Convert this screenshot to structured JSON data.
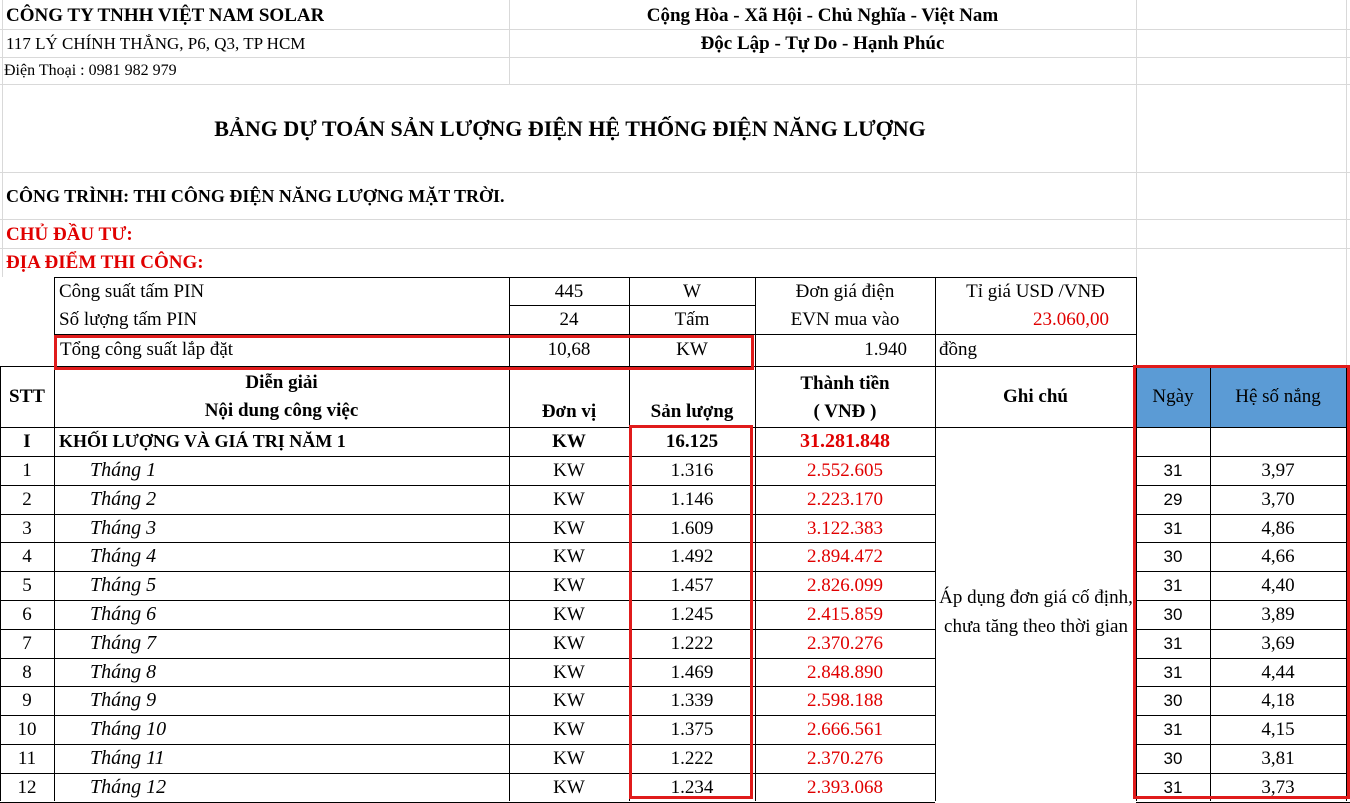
{
  "header": {
    "company": "CÔNG TY TNHH VIỆT NAM SOLAR",
    "address": "117 LÝ CHÍNH THẮNG, P6, Q3, TP HCM",
    "phone": "Điện Thoại : 0981 982 979",
    "motto1": "Cộng Hòa - Xã Hội - Chủ Nghĩa - Việt Nam",
    "motto2": "Độc Lập - Tự Do - Hạnh Phúc"
  },
  "title": "BẢNG DỰ TOÁN SẢN LƯỢNG ĐIỆN HỆ THỐNG ĐIỆN NĂNG LƯỢNG",
  "project": "CÔNG TRÌNH: THI CÔNG ĐIỆN NĂNG LƯỢNG MẶT TRỜI.",
  "investor": "CHỦ ĐẦU TƯ:",
  "location": "ĐỊA ĐIỂM THI CÔNG:",
  "specs": {
    "r1": {
      "label": "Công suất tấm PIN",
      "value": "445",
      "unit": "W",
      "price_label": "Đơn giá điện",
      "rate_label": "Tỉ giá USD /VNĐ"
    },
    "r2": {
      "label": "Số lượng tấm PIN",
      "value": "24",
      "unit": "Tấm",
      "price_label": "EVN mua vào",
      "rate_value": "23.060,00"
    },
    "r3": {
      "label": "Tổng công suất lắp đặt",
      "value": "10,68",
      "unit": "KW",
      "price_value": "1.940",
      "currency": "đồng"
    }
  },
  "table": {
    "h_stt": "STT",
    "h_desc1": "Diễn giải",
    "h_desc2": "Nội dung công việc",
    "h_unit": "Đơn vị",
    "h_output": "Sản lượng",
    "h_amount1": "Thành tiền",
    "h_amount2": "( VNĐ )",
    "h_note": "Ghi chú",
    "h_days": "Ngày",
    "h_sun": "Hệ số nắng",
    "summary": {
      "stt": "I",
      "desc": "KHỐI LƯỢNG VÀ GIÁ TRỊ NĂM 1",
      "unit": "KW",
      "output": "16.125",
      "amount": "31.281.848"
    },
    "note": "Áp dụng đơn giá cố định, chưa tăng theo thời gian",
    "rows": [
      {
        "stt": "1",
        "desc": "Tháng 1",
        "unit": "KW",
        "output": "1.316",
        "amount": "2.552.605",
        "days": "31",
        "sun": "3,97"
      },
      {
        "stt": "2",
        "desc": "Tháng 2",
        "unit": "KW",
        "output": "1.146",
        "amount": "2.223.170",
        "days": "29",
        "sun": "3,70"
      },
      {
        "stt": "3",
        "desc": "Tháng 3",
        "unit": "KW",
        "output": "1.609",
        "amount": "3.122.383",
        "days": "31",
        "sun": "4,86"
      },
      {
        "stt": "4",
        "desc": "Tháng 4",
        "unit": "KW",
        "output": "1.492",
        "amount": "2.894.472",
        "days": "30",
        "sun": "4,66"
      },
      {
        "stt": "5",
        "desc": "Tháng 5",
        "unit": "KW",
        "output": "1.457",
        "amount": "2.826.099",
        "days": "31",
        "sun": "4,40"
      },
      {
        "stt": "6",
        "desc": "Tháng 6",
        "unit": "KW",
        "output": "1.245",
        "amount": "2.415.859",
        "days": "30",
        "sun": "3,89"
      },
      {
        "stt": "7",
        "desc": "Tháng 7",
        "unit": "KW",
        "output": "1.222",
        "amount": "2.370.276",
        "days": "31",
        "sun": "3,69"
      },
      {
        "stt": "8",
        "desc": "Tháng 8",
        "unit": "KW",
        "output": "1.469",
        "amount": "2.848.890",
        "days": "31",
        "sun": "4,44"
      },
      {
        "stt": "9",
        "desc": "Tháng 9",
        "unit": "KW",
        "output": "1.339",
        "amount": "2.598.188",
        "days": "30",
        "sun": "4,18"
      },
      {
        "stt": "10",
        "desc": "Tháng 10",
        "unit": "KW",
        "output": "1.375",
        "amount": "2.666.561",
        "days": "31",
        "sun": "4,15"
      },
      {
        "stt": "11",
        "desc": "Tháng 11",
        "unit": "KW",
        "output": "1.222",
        "amount": "2.370.276",
        "days": "30",
        "sun": "3,81"
      },
      {
        "stt": "12",
        "desc": "Tháng 12",
        "unit": "KW",
        "output": "1.234",
        "amount": "2.393.068",
        "days": "31",
        "sun": "3,73"
      }
    ]
  },
  "colors": {
    "red_text": "#e00000",
    "highlight_box": "#e01b1b",
    "header_fill": "#5b9bd5"
  }
}
